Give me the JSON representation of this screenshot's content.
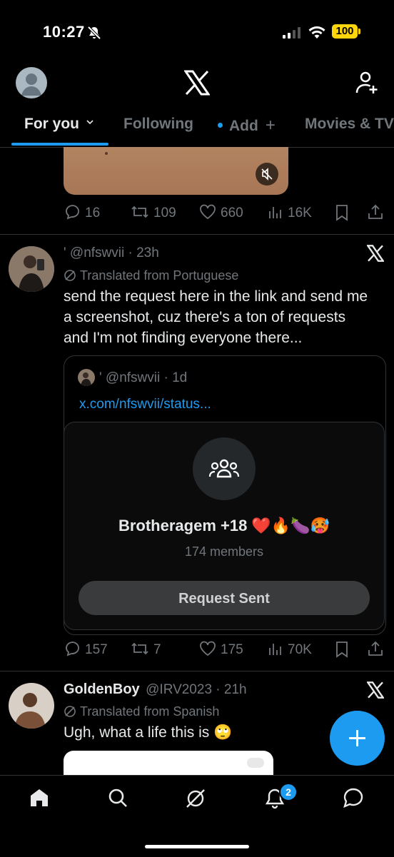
{
  "status_bar": {
    "time": "10:27",
    "battery": "100"
  },
  "tabs": [
    {
      "label": "For you"
    },
    {
      "label": "Following"
    },
    {
      "label": "Add"
    },
    {
      "label": "Movies & TV"
    }
  ],
  "post1": {
    "replies": "16",
    "reposts": "109",
    "likes": "660",
    "views": "16K"
  },
  "post2": {
    "handle": "' @nfswvii · 23h",
    "translated": "Translated from Portuguese",
    "text_line1": "send the request here in the link and send me",
    "text_line2": "a screenshot, cuz there's a ton of requests",
    "text_line3": "and I'm not finding everyone there...",
    "quote": {
      "handle": "' @nfswvii · 1d",
      "link": "x.com/nfswvii/status...",
      "community_name": "Brotheragem +18 ❤️🔥🍆🥵",
      "members": "174 members",
      "button": "Request Sent"
    },
    "replies": "157",
    "reposts": "7",
    "likes": "175",
    "views": "70K"
  },
  "post3": {
    "name": "GoldenBoy",
    "handle": "@IRV2023 · 21h",
    "translated": "Translated from Spanish",
    "text": "Ugh, what a life this is 🙄"
  },
  "nav": {
    "notifications_badge": "2"
  },
  "colors": {
    "accent": "#1d9bf0",
    "muted": "#71767b",
    "background": "#000000",
    "battery": "#ffd60a"
  }
}
